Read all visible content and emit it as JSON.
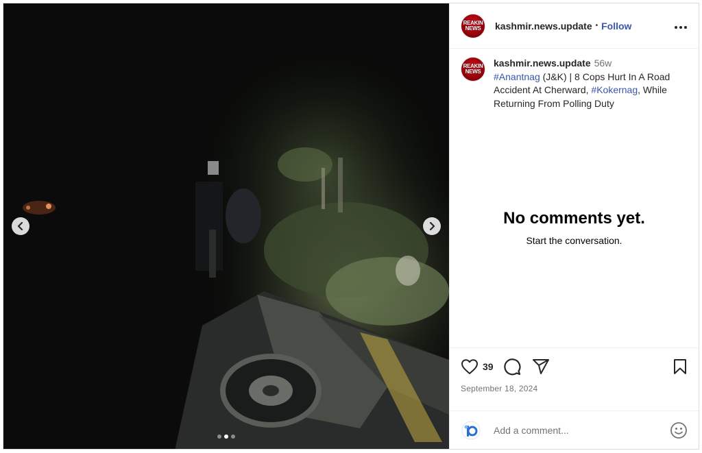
{
  "post": {
    "username": "kashmir.news.update",
    "follow_label": "Follow",
    "separator": "•",
    "more_icon": "more-horizontal-icon",
    "avatar_text": [
      "REAKIN",
      "NEWS"
    ]
  },
  "caption": {
    "username": "kashmir.news.update",
    "time": "56w",
    "hashtag_1": "#Anantnag",
    "text_1": " (J&K) | 8 Cops Hurt In A Road Accident At Cherward, ",
    "hashtag_2": "#Kokernag",
    "text_2": ", While Returning From Polling Duty"
  },
  "comments": {
    "empty_title": "No comments yet.",
    "empty_subtitle": "Start the conversation."
  },
  "actions": {
    "like_count": "39",
    "date": "September 18, 2024",
    "icons": [
      "heart-icon",
      "comment-icon",
      "share-icon",
      "bookmark-icon"
    ]
  },
  "comment_bar": {
    "placeholder": "Add a comment...",
    "emoji_icon": "smiley-icon"
  },
  "carousel": {
    "slide_count": 3,
    "active_index": 1
  }
}
